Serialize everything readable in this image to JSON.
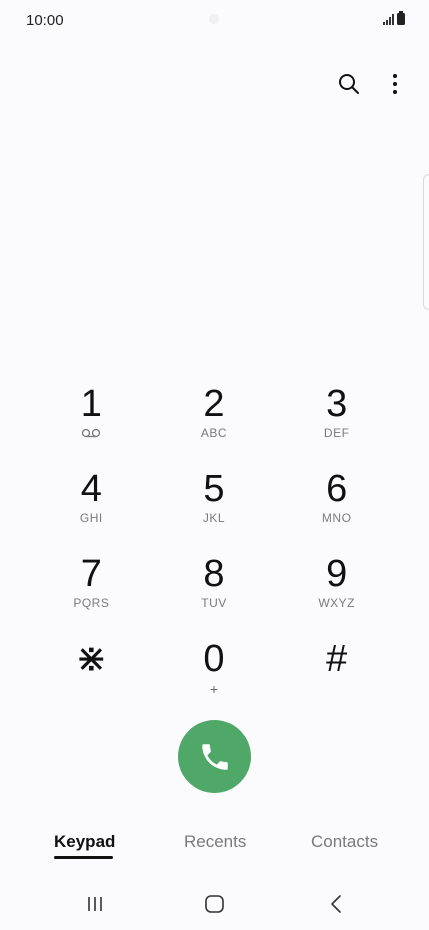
{
  "status_bar": {
    "time": "10:00"
  },
  "top_bar": {
    "search_icon": "search-icon",
    "more_icon": "more-vertical-icon"
  },
  "keypad": {
    "keys": [
      {
        "digit": "1",
        "letters": ""
      },
      {
        "digit": "2",
        "letters": "ABC"
      },
      {
        "digit": "3",
        "letters": "DEF"
      },
      {
        "digit": "4",
        "letters": "GHI"
      },
      {
        "digit": "5",
        "letters": "JKL"
      },
      {
        "digit": "6",
        "letters": "MNO"
      },
      {
        "digit": "7",
        "letters": "PQRS"
      },
      {
        "digit": "8",
        "letters": "TUV"
      },
      {
        "digit": "9",
        "letters": "WXYZ"
      },
      {
        "digit": "⋇",
        "letters": ""
      },
      {
        "digit": "0",
        "letters": "+"
      },
      {
        "digit": "#",
        "letters": ""
      }
    ]
  },
  "call_button": {
    "icon": "phone-icon",
    "color": "#50a868"
  },
  "tabs": [
    {
      "label": "Keypad",
      "active": true
    },
    {
      "label": "Recents",
      "active": false
    },
    {
      "label": "Contacts",
      "active": false
    }
  ],
  "nav": {
    "recents_icon": "recent-apps-icon",
    "home_icon": "home-icon",
    "back_icon": "back-icon"
  }
}
